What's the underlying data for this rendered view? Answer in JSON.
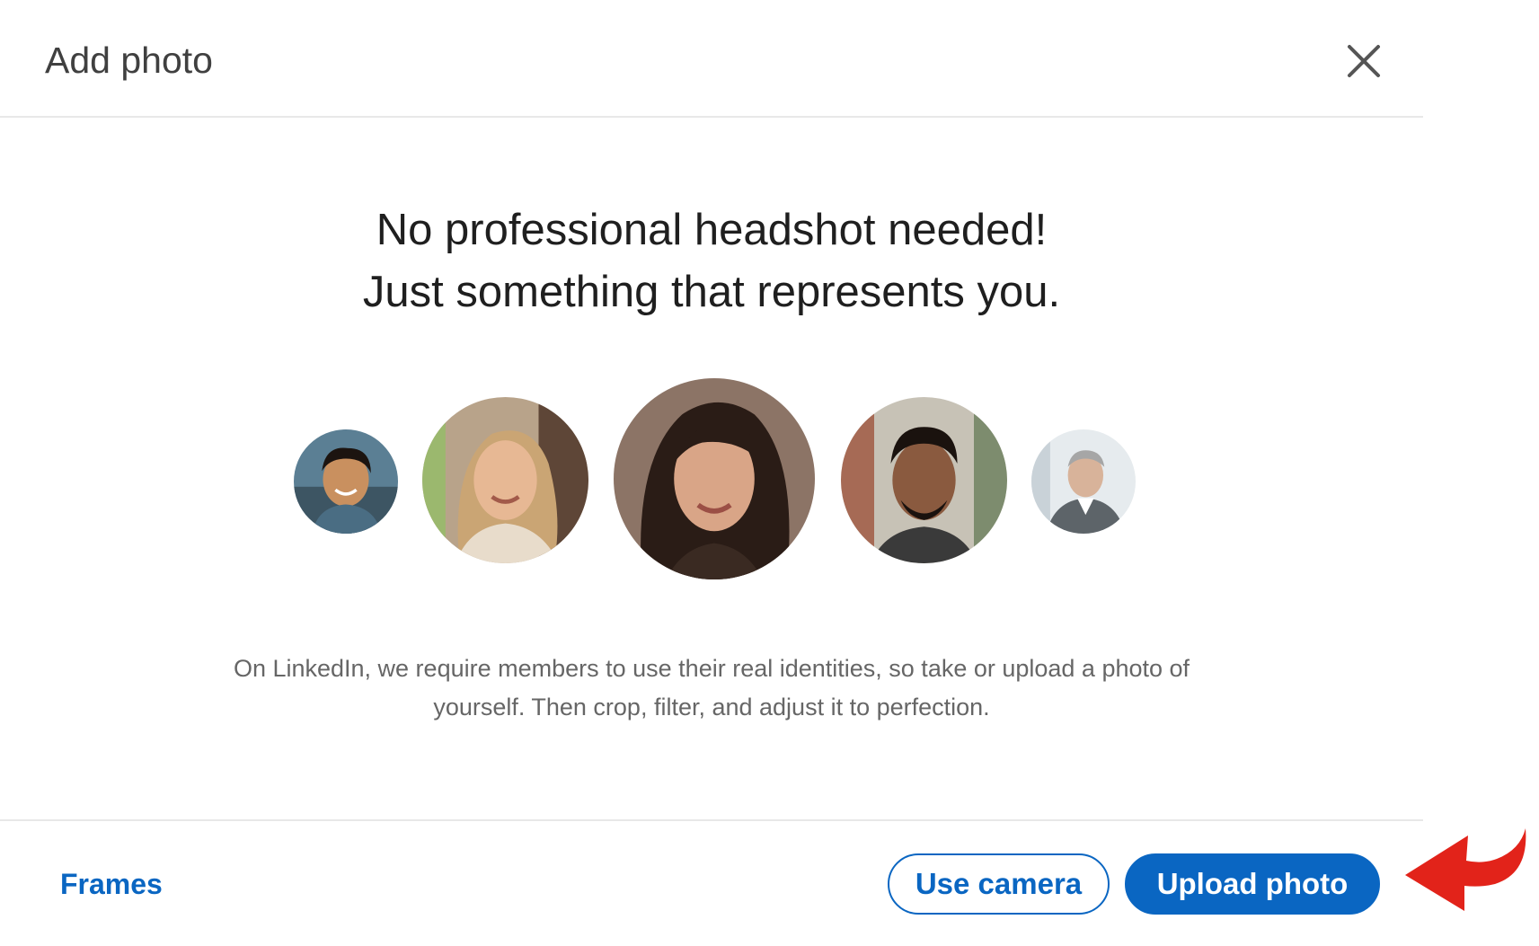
{
  "dialog": {
    "title": "Add photo",
    "close_icon": "close-icon"
  },
  "main": {
    "headline_line1": "No professional headshot needed!",
    "headline_line2": "Just something that represents you.",
    "description": "On LinkedIn, we require members to use their real identities, so take or upload a photo of yourself. Then crop, filter, and adjust it to perfection."
  },
  "footer": {
    "frames_label": "Frames",
    "use_camera_label": "Use camera",
    "upload_photo_label": "Upload photo"
  },
  "colors": {
    "accent": "#0a66c2",
    "arrow": "#e2231a",
    "title_text": "#404040",
    "body_text": "#666666"
  },
  "annotation": {
    "icon": "curved-arrow-icon"
  }
}
